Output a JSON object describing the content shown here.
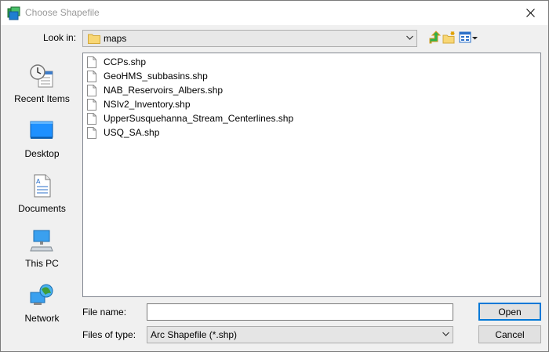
{
  "window": {
    "title": "Choose Shapefile"
  },
  "look_in": {
    "label": "Look in:",
    "folder": "maps"
  },
  "places": [
    {
      "label": "Recent Items",
      "icon": "recent-items-icon"
    },
    {
      "label": "Desktop",
      "icon": "desktop-icon"
    },
    {
      "label": "Documents",
      "icon": "documents-icon"
    },
    {
      "label": "This PC",
      "icon": "this-pc-icon"
    },
    {
      "label": "Network",
      "icon": "network-icon"
    }
  ],
  "files": [
    "CCPs.shp",
    "GeoHMS_subbasins.shp",
    "NAB_Reservoirs_Albers.shp",
    "NSIv2_Inventory.shp",
    "UpperSusquehanna_Stream_Centerlines.shp",
    "USQ_SA.shp"
  ],
  "file_name": {
    "label": "File name:",
    "value": ""
  },
  "file_type": {
    "label": "Files of type:",
    "value": "Arc Shapefile (*.shp)"
  },
  "buttons": {
    "open": "Open",
    "cancel": "Cancel"
  }
}
